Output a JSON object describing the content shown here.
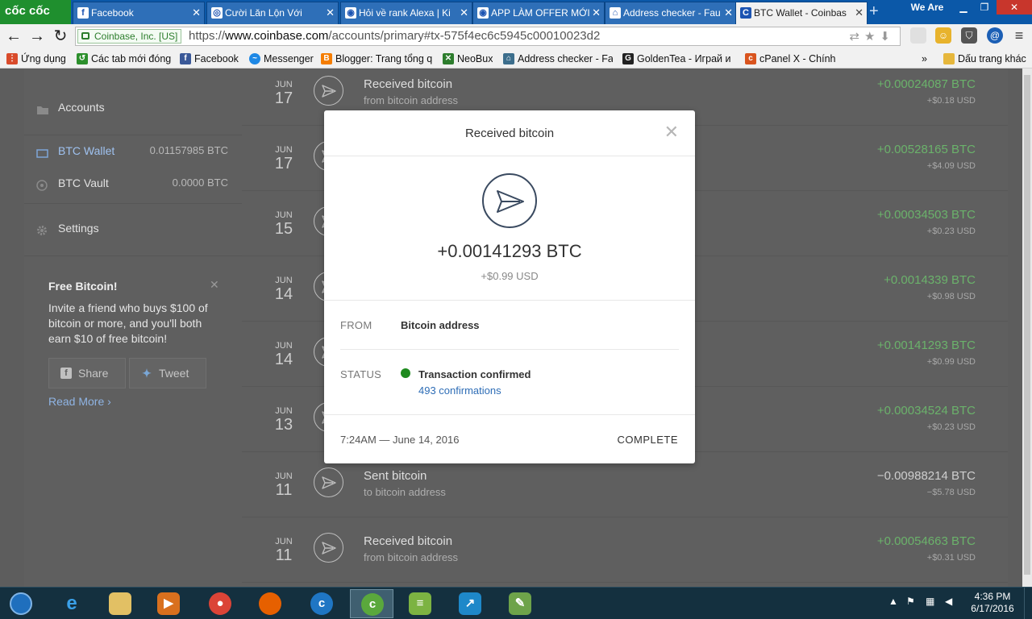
{
  "browser": {
    "brand": "cốc cốc",
    "tabs": [
      {
        "label": "Facebook",
        "icon": "f"
      },
      {
        "label": "Cười Lăn Lộn Với",
        "icon": "◎"
      },
      {
        "label": "Hỏi về rank Alexa | Ki",
        "icon": "◉"
      },
      {
        "label": "APP LÀM OFFER MỚI",
        "icon": "◉"
      },
      {
        "label": "Address checker - Fau",
        "icon": "⌂"
      },
      {
        "label": "BTC Wallet - Coinbas",
        "icon": "C"
      }
    ],
    "we_are": "We Are",
    "ev_cert": "Coinbase, Inc. [US]",
    "url_scheme": "https://",
    "url_host": "www.coinbase.com",
    "url_path": "/accounts/primary#tx-575f4ec6c5945c00010023d2",
    "bookmarks": [
      {
        "label": "Ứng dụng",
        "icon": "apps-icon",
        "color": "#d94b2b"
      },
      {
        "label": "Các tab mới đóng",
        "icon": "history-icon",
        "color": "#2c8f2c"
      },
      {
        "label": "Facebook",
        "icon": "facebook-icon",
        "color": "#3b5998"
      },
      {
        "label": "Messenger",
        "icon": "messenger-icon",
        "color": "#1e88e5"
      },
      {
        "label": "Blogger: Trang tổng q",
        "icon": "blogger-icon",
        "color": "#f57d00"
      },
      {
        "label": "NeoBux",
        "icon": "neobux-icon",
        "color": "#2d7d2d"
      },
      {
        "label": "Address checker - Fau",
        "icon": "home-icon",
        "color": "#3c6e8c"
      },
      {
        "label": "GoldenTea - Играй и",
        "icon": "golden-icon",
        "color": "#222222"
      },
      {
        "label": "cPanel X - Chính",
        "icon": "cpanel-icon",
        "color": "#d9541e"
      }
    ],
    "other_bookmarks": "Dấu trang khác"
  },
  "sidebar": {
    "accounts_label": "Accounts",
    "wallets": [
      {
        "label": "BTC Wallet",
        "amount": "0.01157985 BTC",
        "icon": "wallet-icon"
      },
      {
        "label": "BTC Vault",
        "amount": "0.0000 BTC",
        "icon": "vault-icon"
      }
    ],
    "settings_label": "Settings",
    "promo": {
      "title": "Free Bitcoin!",
      "text": "Invite a friend who buys $100 of bitcoin or more, and you'll both earn $10 of free bitcoin!",
      "share_label": "Share",
      "tweet_label": "Tweet",
      "read_more": "Read More ›"
    }
  },
  "transactions": [
    {
      "month": "JUN",
      "day": "17",
      "title": "Received bitcoin",
      "subtitle": "from bitcoin address",
      "btc": "+0.00024087 BTC",
      "usd": "+$0.18 USD"
    },
    {
      "month": "JUN",
      "day": "17",
      "title": "",
      "subtitle": "",
      "btc": "+0.00528165 BTC",
      "usd": "+$4.09 USD"
    },
    {
      "month": "JUN",
      "day": "15",
      "title": "",
      "subtitle": "",
      "btc": "+0.00034503 BTC",
      "usd": "+$0.23 USD"
    },
    {
      "month": "JUN",
      "day": "14",
      "title": "",
      "subtitle": "",
      "btc": "+0.0014339 BTC",
      "usd": "+$0.98 USD"
    },
    {
      "month": "JUN",
      "day": "14",
      "title": "",
      "subtitle": "",
      "btc": "+0.00141293 BTC",
      "usd": "+$0.99 USD"
    },
    {
      "month": "JUN",
      "day": "13",
      "title": "",
      "subtitle": "",
      "btc": "+0.00034524 BTC",
      "usd": "+$0.23 USD"
    },
    {
      "month": "JUN",
      "day": "11",
      "title": "Sent bitcoin",
      "subtitle": "to bitcoin address",
      "btc": "−0.00988214 BTC",
      "usd": "−$5.78 USD",
      "negative": true
    },
    {
      "month": "JUN",
      "day": "11",
      "title": "Received bitcoin",
      "subtitle": "from bitcoin address",
      "btc": "+0.00054663 BTC",
      "usd": "+$0.31 USD"
    }
  ],
  "modal": {
    "title": "Received bitcoin",
    "amount": "+0.00141293 BTC",
    "usd": "+$0.99 USD",
    "from_label": "FROM",
    "from_value": "Bitcoin address",
    "status_label": "STATUS",
    "status_value": "Transaction confirmed",
    "confirmations": "493 confirmations",
    "timestamp": "7:24AM — June 14, 2016",
    "state": "COMPLETE"
  },
  "taskbar": {
    "apps": [
      "start",
      "ie",
      "explorer",
      "media",
      "chrome",
      "firefox",
      "coccoc-alt",
      "coccoc",
      "bluestacks",
      "remote",
      "notepad"
    ],
    "time": "4:36 PM",
    "date": "6/17/2016"
  },
  "colors": {
    "positive": "#6bb26b",
    "link": "#2e6db6",
    "confirmed": "#1e8a1e"
  }
}
